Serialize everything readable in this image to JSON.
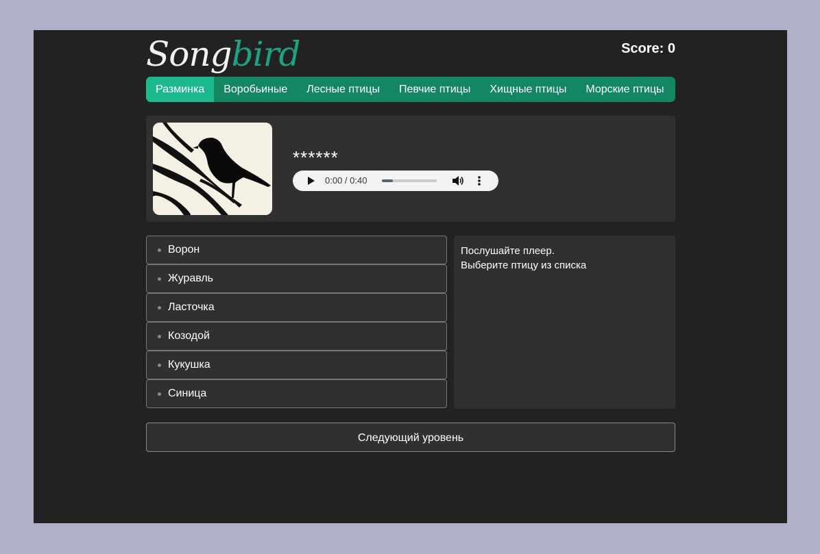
{
  "header": {
    "logo_part1": "Song",
    "logo_part2": "bird",
    "score": "Score: 0"
  },
  "nav": {
    "items": [
      {
        "label": "Разминка",
        "active": true
      },
      {
        "label": "Воробьиные",
        "active": false
      },
      {
        "label": "Лесные птицы",
        "active": false
      },
      {
        "label": "Певчие птицы",
        "active": false
      },
      {
        "label": "Хищные птицы",
        "active": false
      },
      {
        "label": "Морские птицы",
        "active": false
      }
    ]
  },
  "question": {
    "hidden_name": "******",
    "player": {
      "time": "0:00 / 0:40",
      "progress": 0.2,
      "play_icon": "play-icon",
      "volume_icon": "volume-icon",
      "more_icon": "more-vert-icon"
    }
  },
  "answers": [
    {
      "label": "Ворон"
    },
    {
      "label": "Журавль"
    },
    {
      "label": "Ласточка"
    },
    {
      "label": "Козодой"
    },
    {
      "label": "Кукушка"
    },
    {
      "label": "Синица"
    }
  ],
  "info": {
    "line1": "Послушайте плеер.",
    "line2": "Выберите птицу из списка"
  },
  "next_button": "Следующий уровень",
  "colors": {
    "page_bg": "#aeb1c8",
    "frame_bg": "#222222",
    "panel_bg": "#303030",
    "nav_bg": "#138663",
    "nav_active": "#1db98e",
    "logo_accent": "#1ea283"
  }
}
